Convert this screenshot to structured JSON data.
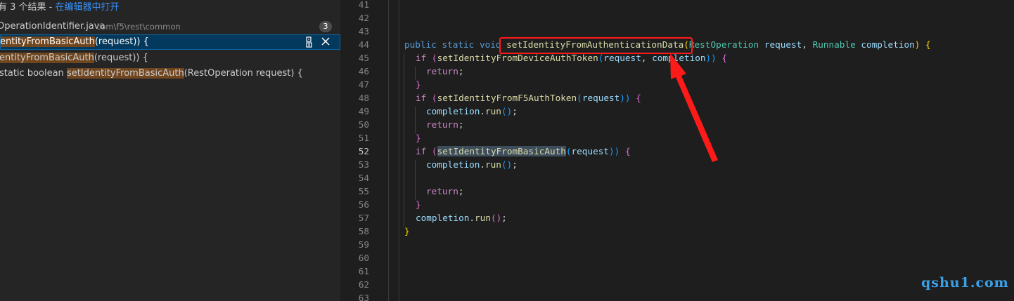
{
  "search": {
    "summary_prefix": "有 3 个结果 - ",
    "open_in_editor": "在编辑器中打开",
    "file": {
      "name": "OperationIdentifier.java",
      "path": "com\\f5\\rest\\common",
      "match_count": "3"
    },
    "matches": [
      {
        "before": "",
        "highlight": "entityFromBasicAuth",
        "after": "(request)) {"
      },
      {
        "before": "",
        "highlight": "entityFromBasicAuth",
        "after": "(request)) {"
      },
      {
        "before": " static boolean ",
        "highlight": "setIdentityFromBasicAuth",
        "after": "(RestOperation request) {"
      }
    ],
    "actions": {
      "replace_icon": "replace-icon",
      "dismiss_icon": "close-icon"
    }
  },
  "editor": {
    "line_numbers": [
      "41",
      "42",
      "43",
      "44",
      "45",
      "46",
      "47",
      "48",
      "49",
      "50",
      "51",
      "52",
      "53",
      "54",
      "55",
      "56",
      "57",
      "58",
      "59",
      "60",
      "61",
      "62",
      "63"
    ],
    "active_line": "52",
    "code": {
      "l44": {
        "kw1": "public",
        "kw2": "static",
        "kw3": "void",
        "fn": "setIdentityFromAuthenticationData",
        "b_open": "(",
        "t1": "RestOperation",
        "v1": "request",
        "comma": ",",
        "t2": "Runnable",
        "v2": "completion",
        "b_close": ")",
        "brace": "{"
      },
      "l45": {
        "kw": "if",
        "p1": "(",
        "fn": "setIdentityFromDeviceAuthToken",
        "p2": "(",
        "v1": "request",
        "comma": ",",
        "v2": "completion",
        "p3": "))",
        "brace": "{"
      },
      "l46": {
        "kw": "return",
        "semi": ";"
      },
      "l47": {
        "brace": "}"
      },
      "l48": {
        "kw": "if",
        "p1": "(",
        "fn": "setIdentityFromF5AuthToken",
        "p2": "(",
        "v1": "request",
        "p3": "))",
        "brace": "{"
      },
      "l49": {
        "v": "completion",
        "dot": ".",
        "fn": "run",
        "p": "()",
        "semi": ";"
      },
      "l50": {
        "kw": "return",
        "semi": ";"
      },
      "l51": {
        "brace": "}"
      },
      "l52": {
        "kw": "if",
        "p1": "(",
        "fn": "setIdentityFromBasicAuth",
        "p2": "(",
        "v1": "request",
        "p3": "))",
        "brace": "{"
      },
      "l53": {
        "v": "completion",
        "dot": ".",
        "fn": "run",
        "p": "()",
        "semi": ";"
      },
      "l55": {
        "kw": "return",
        "semi": ";"
      },
      "l56": {
        "brace": "}"
      },
      "l57": {
        "v": "completion",
        "dot": ".",
        "fn": "run",
        "p": "()",
        "semi": ";"
      },
      "l58": {
        "brace": "}"
      }
    }
  },
  "annotation": {
    "color": "#ff1a1a"
  },
  "watermark": "qshu1.com"
}
